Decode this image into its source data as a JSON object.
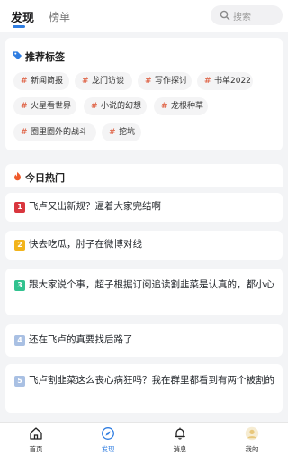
{
  "header": {
    "tabs": [
      {
        "label": "发现"
      },
      {
        "label": "榜单"
      }
    ],
    "search": {
      "placeholder": "搜索",
      "icon": "search-icon"
    }
  },
  "tags_section": {
    "title": "推荐标签",
    "icon": "tag-icon",
    "items": [
      "新闻简报",
      "龙门访谈",
      "写作探讨",
      "书单2022",
      "火星看世界",
      "小说的幻想",
      "龙根种草",
      "圈里圈外的战斗",
      "挖坑"
    ]
  },
  "hot_section": {
    "title": "今日热门",
    "icon": "fire-icon",
    "items": [
      {
        "rank": "1",
        "text": "飞卢又出新规？逼着大家完结啊"
      },
      {
        "rank": "2",
        "text": "快去吃瓜，肘子在微博对线"
      },
      {
        "rank": "3",
        "text": "跟大家说个事，超子根据订阅追读割韭菜是认真的，都小心"
      },
      {
        "rank": "4",
        "text": "还在飞卢的真要找后路了"
      },
      {
        "rank": "5",
        "text": "飞卢割韭菜这么丧心病狂吗？我在群里都看到有两个被割的"
      }
    ]
  },
  "bottom_nav": {
    "items": [
      {
        "label": "首页",
        "icon": "home-icon"
      },
      {
        "label": "发现",
        "icon": "compass-icon"
      },
      {
        "label": "消息",
        "icon": "bell-icon"
      },
      {
        "label": "我的",
        "icon": "avatar-icon"
      }
    ]
  },
  "colors": {
    "accent": "#2f7de1",
    "hash": "#e06a4e",
    "rank1": "#d9363e",
    "rank2": "#f2b41b",
    "rank3": "#31c28f",
    "rank4": "#a9c0e3",
    "rank5": "#a9c0e3"
  }
}
